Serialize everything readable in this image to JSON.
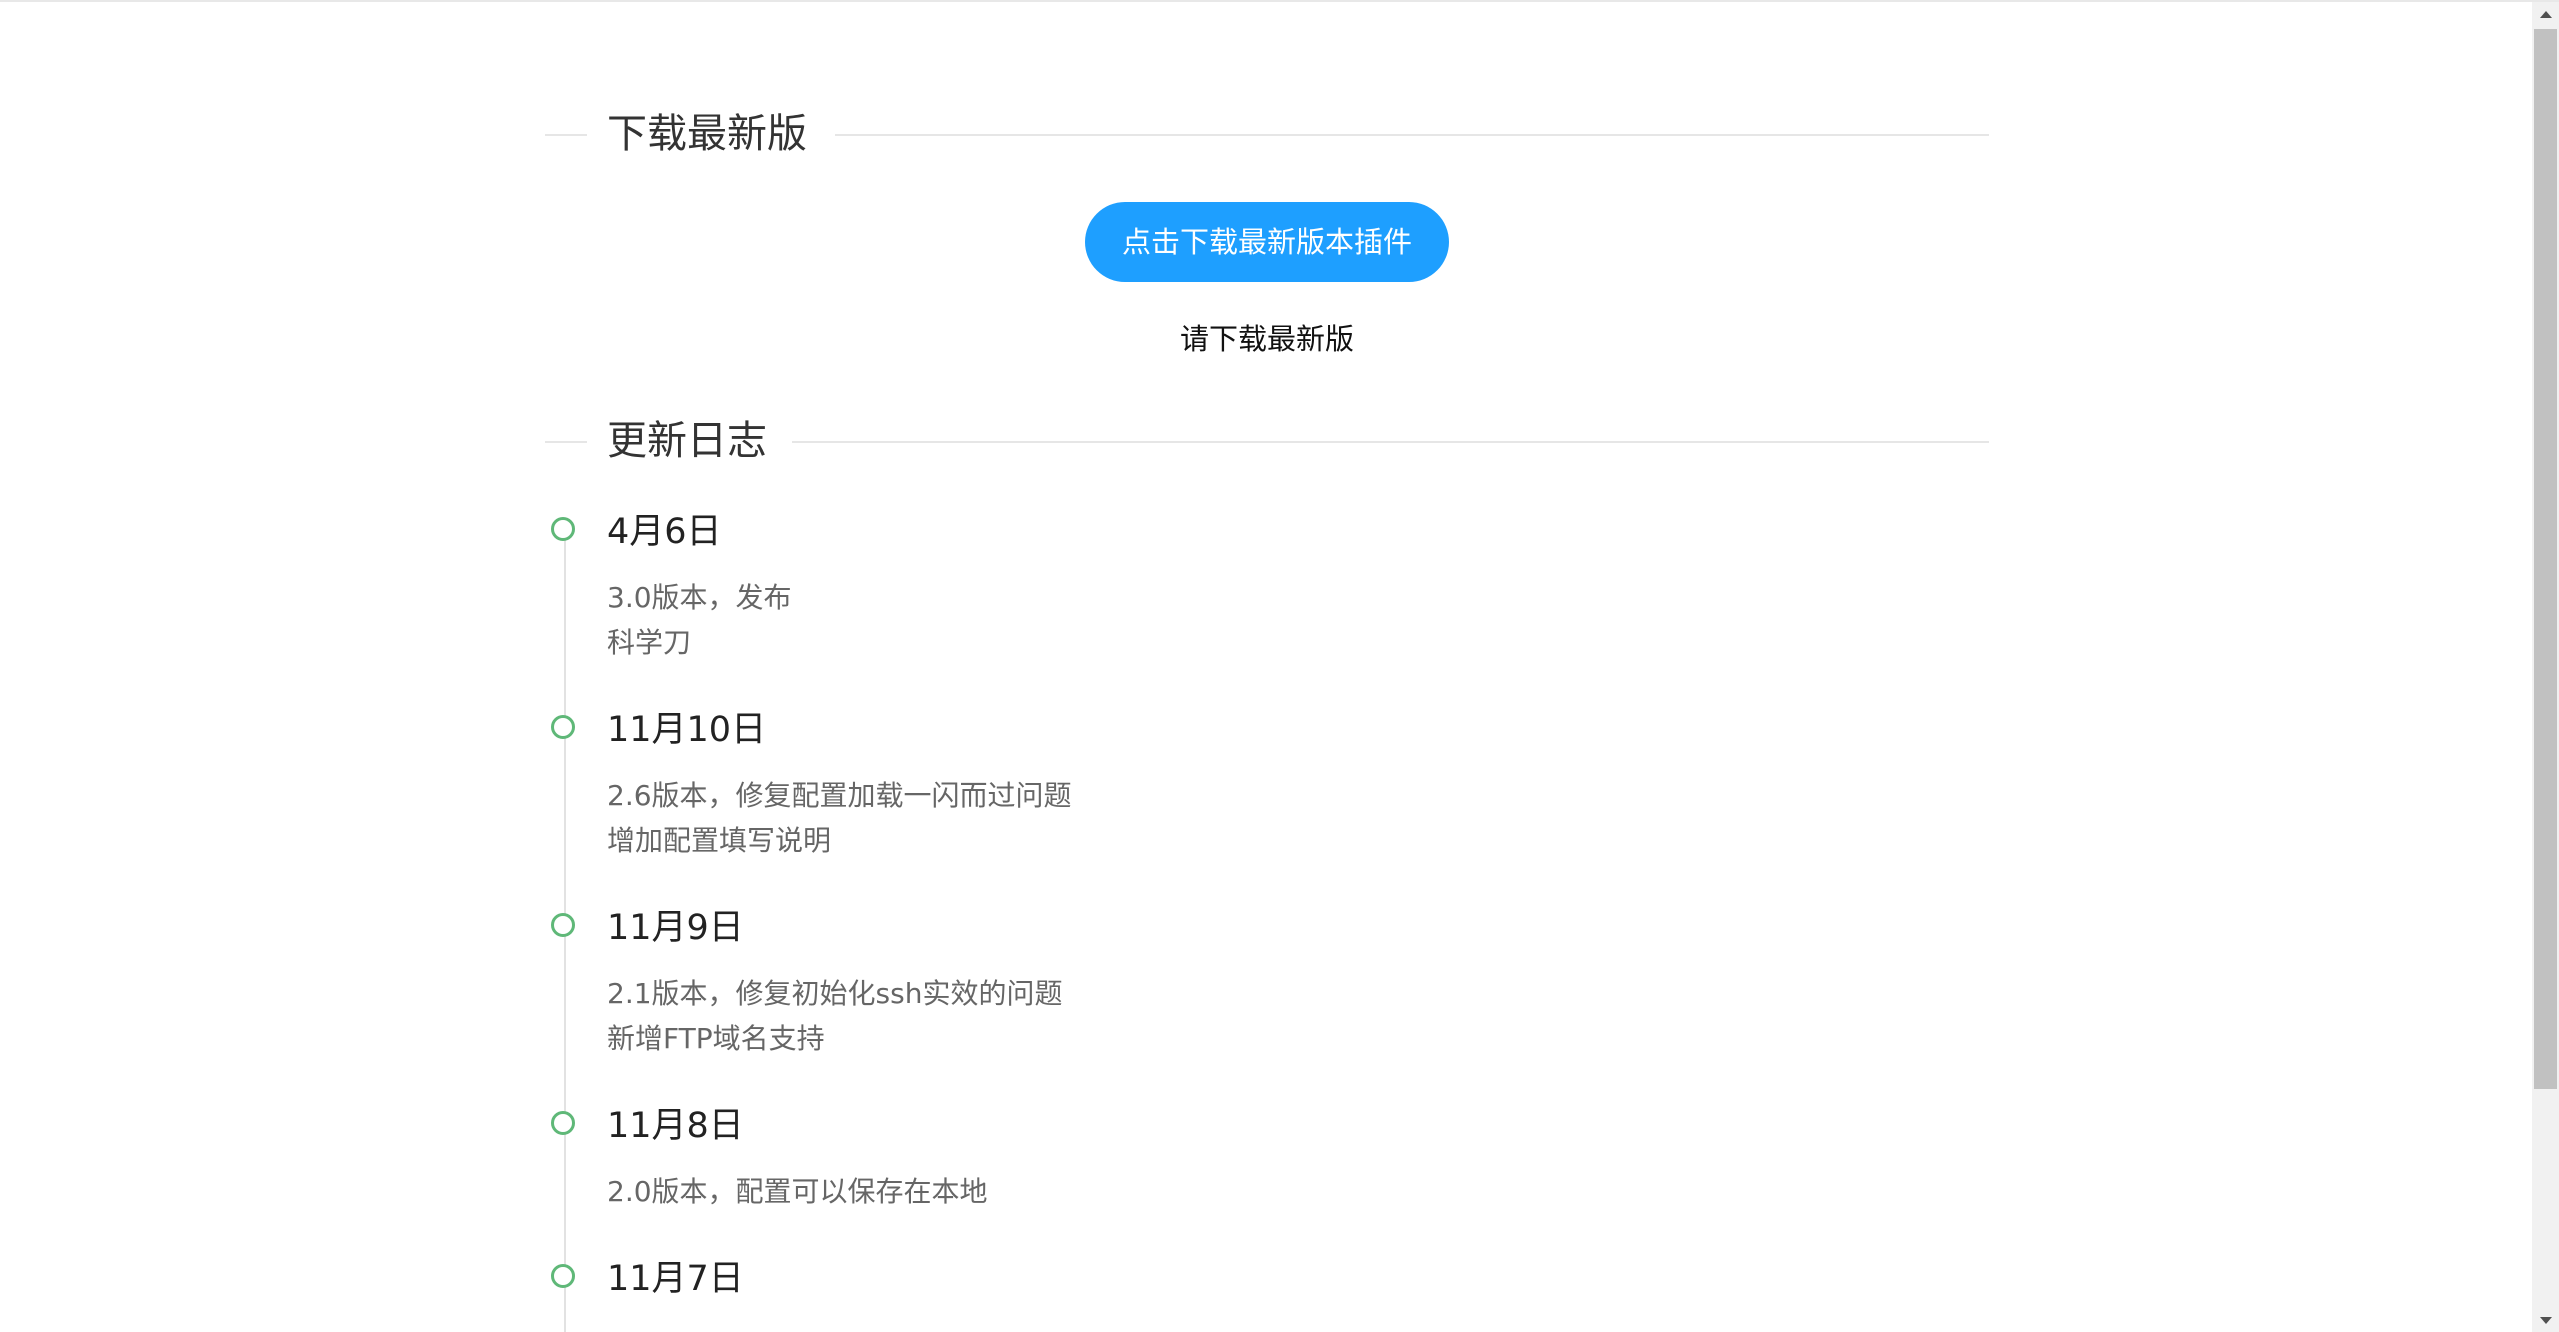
{
  "download_section": {
    "title": "下载最新版",
    "button_label": "点击下载最新版本插件",
    "hint": "请下载最新版"
  },
  "changelog_section": {
    "title": "更新日志",
    "entries": [
      {
        "date": "4月6日",
        "lines": [
          "3.0版本，发布",
          "科学刀"
        ]
      },
      {
        "date": "11月10日",
        "lines": [
          "2.6版本，修复配置加载一闪而过问题",
          "增加配置填写说明"
        ]
      },
      {
        "date": "11月9日",
        "lines": [
          "2.1版本，修复初始化ssh实效的问题",
          "新增FTP域名支持"
        ]
      },
      {
        "date": "11月8日",
        "lines": [
          "2.0版本，配置可以保存在本地"
        ]
      },
      {
        "date": "11月7日",
        "lines": []
      }
    ]
  },
  "colors": {
    "button_bg": "#1e9fff",
    "timeline_dot": "#5fb878",
    "divider": "#e6e6e6"
  },
  "icons": {
    "scroll_up": "triangle-up-icon",
    "scroll_down": "triangle-down-icon"
  }
}
